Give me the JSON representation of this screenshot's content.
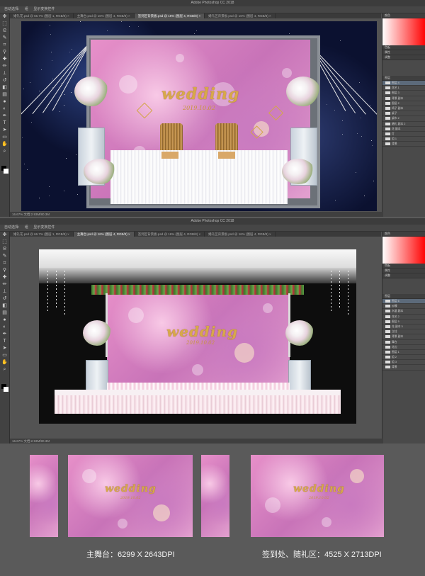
{
  "window1": {
    "title": "Adobe Photoshop CC 2018",
    "options": [
      "自动选择:",
      "组",
      "显示变换控件"
    ],
    "tabs": [
      "婚礼花.psd @ 66.7% (图层 1, RGB/8) ×",
      "主舞台.psd @ 16% (图层 4, RGB/8) ×",
      "签到区背景板.psd @ 16% (图层 4, RGB/8) ×",
      "婚礼区背景板.psd @ 16% (图层 4, RGB/8) ×"
    ],
    "status": "16.67%   文档:2.93M/80.3M",
    "panel_tabs": [
      "颜色",
      "色板",
      "属性",
      "调整",
      "图层"
    ],
    "layers": [
      "图层 4",
      "花艺 1",
      "图层 3",
      "背景 副本",
      "图层 2",
      "椅子 副本",
      "桌子",
      "桌布 2",
      "婚礼 副本 2",
      "花 副本",
      "灯",
      "组 1",
      "背景"
    ]
  },
  "window2": {
    "title": "Adobe Photoshop CC 2018",
    "options": [
      "自动选择:",
      "组",
      "显示变换控件"
    ],
    "tabs": [
      "婚礼花.psd @ 66.7% (图层 1, RGB/8) ×",
      "主舞台.psd @ 16% (图层 4, RGB/8) ×",
      "签到区背景板.psd @ 16% (图层 4, RGB/8) ×",
      "婚礼区背景板.psd @ 16% (图层 4, RGB/8) ×"
    ],
    "status": "16.67%   文档:2.93M/80.3M",
    "panel_tabs": [
      "颜色",
      "色板",
      "属性",
      "调整",
      "图层"
    ],
    "layers": [
      "图层 6",
      "纱幔",
      "水晶 副本",
      "花艺 2",
      "图层 5",
      "花 副本 3",
      "立柱",
      "背景 副本",
      "舞台",
      "花边",
      "图层 1",
      "组 2",
      "组 3",
      "背景"
    ]
  },
  "artwork": {
    "wedding_text": "wedding",
    "date_text": "2019.10.02"
  },
  "captions": {
    "main_stage": "主舞台：6299 X 2643DPI",
    "signin_area": "签到处、随礼区：4525 X 2713DPI"
  },
  "colors": {
    "backdrop_pink": "#e790c9",
    "gold": "#d8a84a",
    "ps_dark": "#535353"
  }
}
